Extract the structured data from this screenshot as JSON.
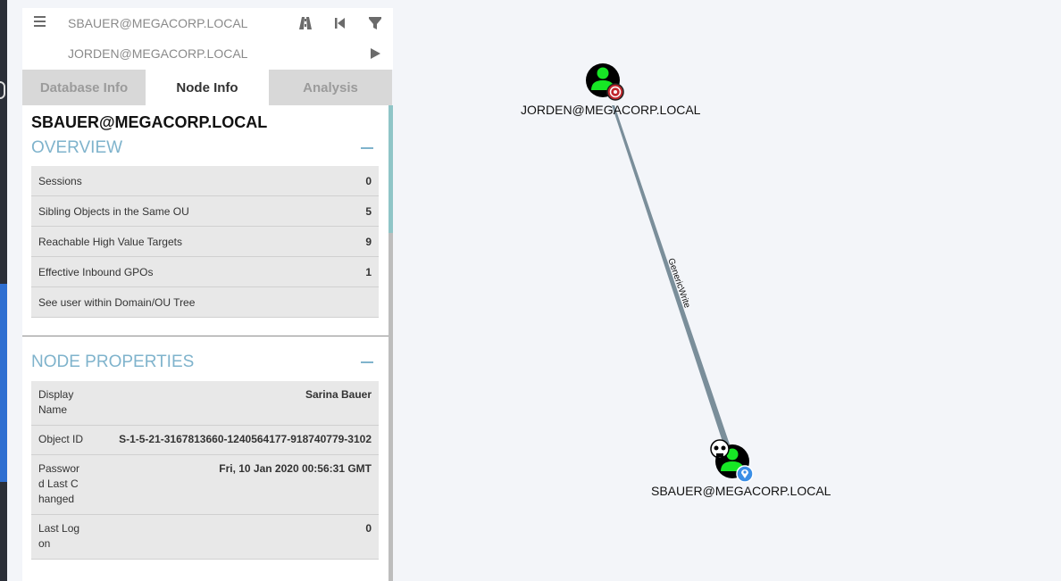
{
  "search": {
    "start_node": "SBAUER@MEGACORP.LOCAL",
    "target_node": "JORDEN@MEGACORP.LOCAL"
  },
  "toolbar_icons": [
    "menu-icon",
    "pathfinding-icon",
    "back-icon",
    "filter-icon",
    "play-icon"
  ],
  "tabs": [
    {
      "label": "Database Info",
      "active": false
    },
    {
      "label": "Node Info",
      "active": true
    },
    {
      "label": "Analysis",
      "active": false
    }
  ],
  "node_info": {
    "title": "SBAUER@MEGACORP.LOCAL",
    "overview": {
      "heading": "OVERVIEW",
      "rows": [
        {
          "label": "Sessions",
          "value": "0"
        },
        {
          "label": "Sibling Objects in the Same OU",
          "value": "5"
        },
        {
          "label": "Reachable High Value Targets",
          "value": "9"
        },
        {
          "label": "Effective Inbound GPOs",
          "value": "1"
        },
        {
          "label": "See user within Domain/OU Tree",
          "value": ""
        }
      ]
    },
    "properties": {
      "heading": "NODE PROPERTIES",
      "rows": [
        {
          "label": "Display Name",
          "value": "Sarina Bauer"
        },
        {
          "label": "Object ID",
          "value": "S-1-5-21-3167813660-1240564177-918740779-3102"
        },
        {
          "label": "Password Last Changed",
          "value": "Fri, 10 Jan 2020 00:56:31 GMT"
        },
        {
          "label": "Last Logon",
          "value": "0"
        }
      ]
    }
  },
  "graph": {
    "nodes": [
      {
        "label": "JORDEN@MEGACORP.LOCAL",
        "badge": "target-icon"
      },
      {
        "label": "SBAUER@MEGACORP.LOCAL",
        "badge": "location-pin-icon",
        "extra": "skull-icon"
      }
    ],
    "edge_label": "GenericWrite",
    "colors": {
      "user_node": "#17e625",
      "node_bg": "#000000",
      "edge": "#7a8e9a",
      "target_badge": "#c0272d",
      "owned_badge": "#3a8ee6"
    }
  }
}
